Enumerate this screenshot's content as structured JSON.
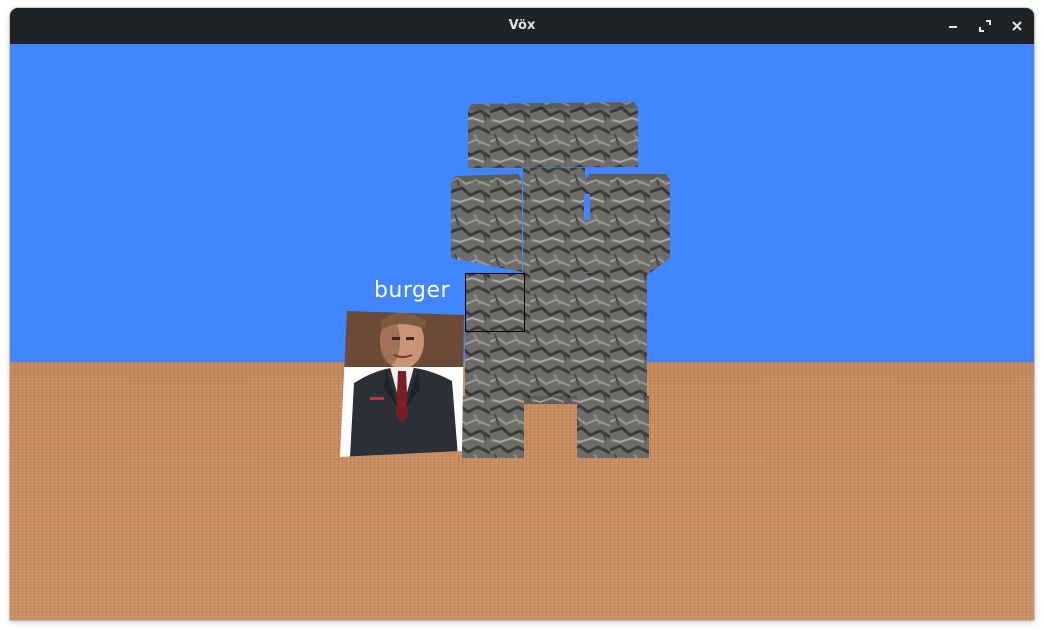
{
  "window": {
    "title": "Vöx",
    "buttons": [
      "minimize-icon",
      "maximize-icon",
      "close-icon"
    ]
  },
  "scene": {
    "sky_color": "#4286ff",
    "ground_color": "#c88d61",
    "stone_color": "#6f6e6b",
    "player": {
      "nametag": "burger"
    }
  }
}
